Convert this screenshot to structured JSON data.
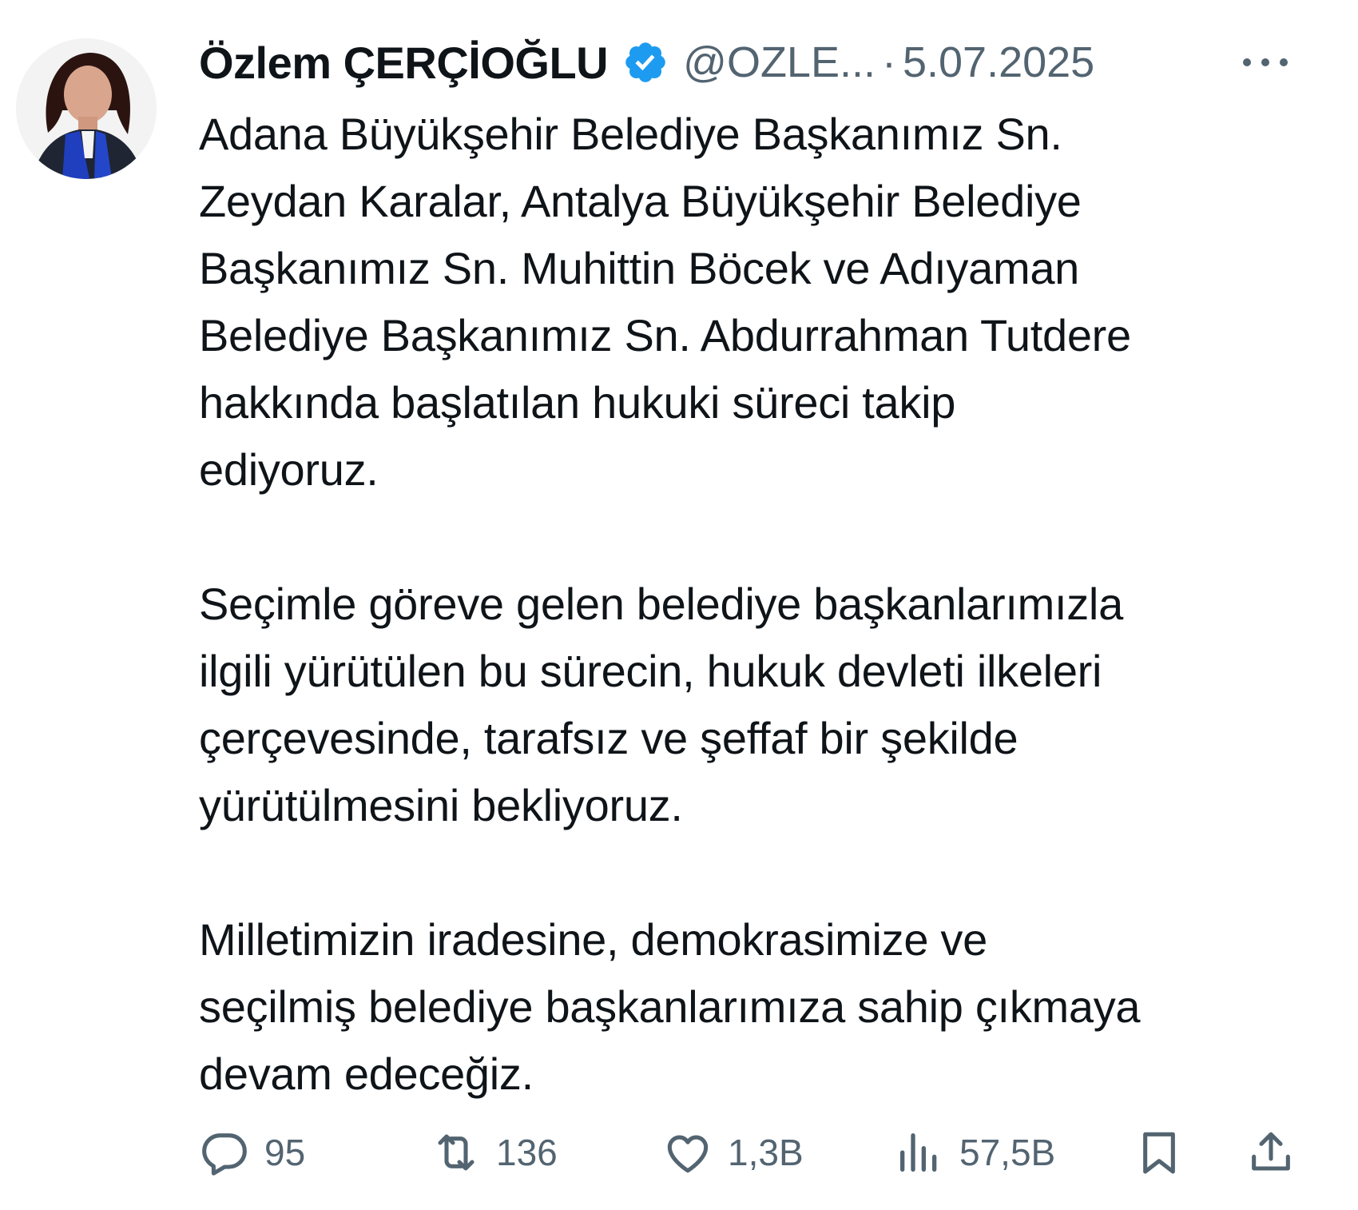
{
  "tweet": {
    "author_name": "Özlem ÇERÇİOĞLU",
    "handle": "@OZLE...",
    "separator": "·",
    "date": "5.07.2025",
    "paragraphs": [
      "Adana Büyükşehir Belediye Başkanımız Sn.\nZeydan Karalar, Antalya Büyükşehir Belediye\nBaşkanımız Sn. Muhittin Böcek ve Adıyaman\nBelediye Başkanımız Sn. Abdurrahman Tutdere\nhakkında başlatılan hukuki süreci takip\nediyoruz.",
      "Seçimle göreve gelen belediye başkanlarımızla\nilgili yürütülen bu sürecin, hukuk devleti ilkeleri\nçerçevesinde, tarafsız ve şeffaf bir şekilde\nyürütülmesini bekliyoruz.",
      "Milletimizin iradesine, demokrasimize ve\nseçilmiş belediye başkanlarımıza sahip çıkmaya\ndevam edeceğiz."
    ]
  },
  "actions": {
    "reply_count": "95",
    "retweet_count": "136",
    "like_count": "1,3B",
    "views_count": "57,5B"
  },
  "icons": {
    "verified": "verified-badge-icon",
    "more": "more-options-icon",
    "reply": "reply-icon",
    "retweet": "retweet-icon",
    "like": "heart-icon",
    "views": "views-chart-icon",
    "bookmark": "bookmark-icon",
    "share": "share-icon"
  },
  "colors": {
    "text": "#0f1419",
    "secondary": "#536471",
    "verified_blue": "#1d9bf0"
  }
}
